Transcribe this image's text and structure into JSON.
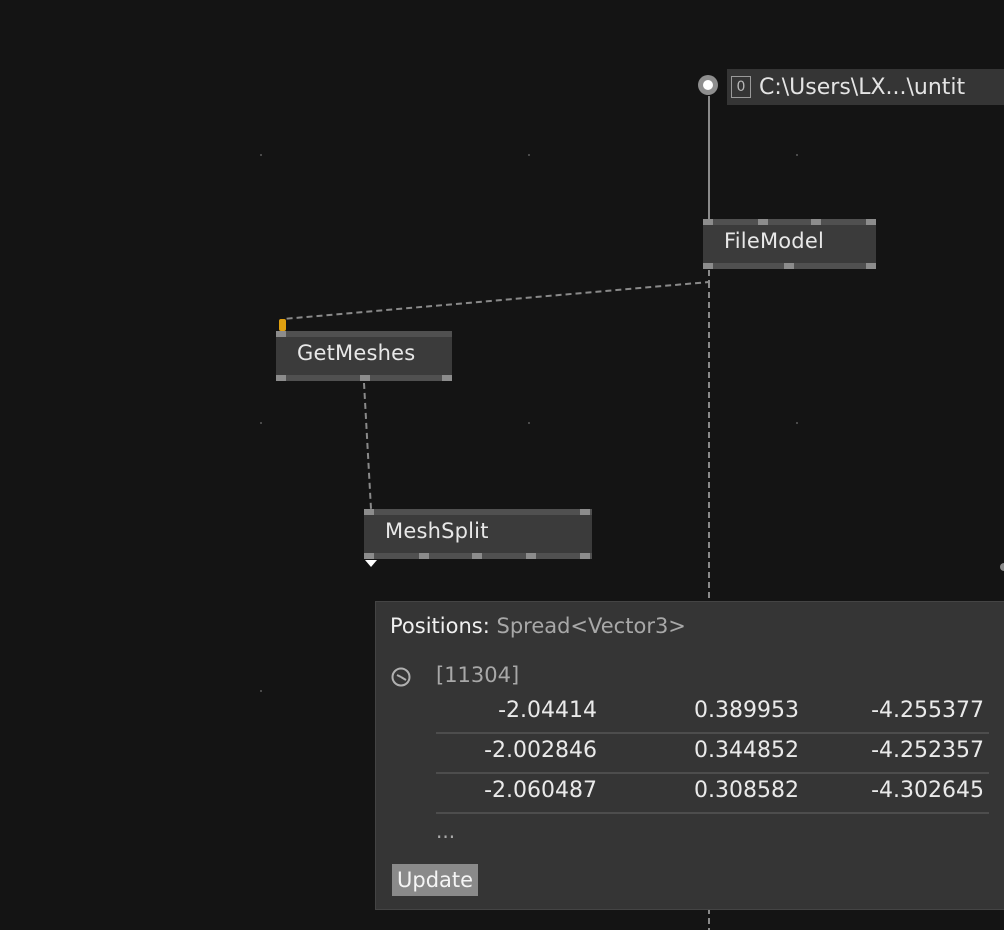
{
  "canvas": {
    "background": "#141414",
    "wire_color": "#8a8a8a"
  },
  "iobox": {
    "index_label": "0",
    "path_text": "C:\\Users\\LX...\\untit"
  },
  "nodes": {
    "filemodel": {
      "title": "FileModel"
    },
    "getmeshes": {
      "title": "GetMeshes"
    },
    "meshsplit": {
      "title": "MeshSplit"
    }
  },
  "tooltip": {
    "pin_name": "Positions",
    "separator": ": ",
    "type_name": "Spread<Vector3>",
    "count": "[11304]",
    "icon": "clock-icon",
    "rows": [
      [
        "-2.04414",
        "0.389953",
        "-4.255377"
      ],
      [
        "-2.002846",
        "0.344852",
        "-4.252357"
      ],
      [
        "-2.060487",
        "0.308582",
        "-4.302645"
      ]
    ],
    "ellipsis": "...",
    "update_label": "Update"
  }
}
